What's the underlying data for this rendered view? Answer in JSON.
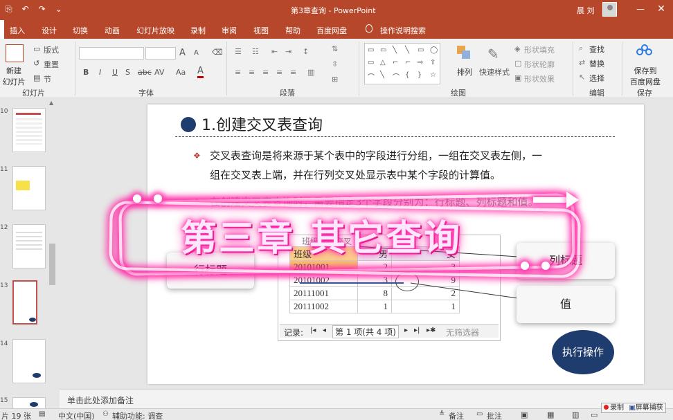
{
  "window": {
    "title": "第3章查询  -  PowerPoint",
    "user": "晨 刘",
    "qat": [
      "⎘",
      "↶",
      "↷",
      "⌄"
    ],
    "minimize": "—",
    "close": "✕"
  },
  "menu": {
    "tabs": [
      "插入",
      "设计",
      "切换",
      "动画",
      "幻灯片放映",
      "录制",
      "审阅",
      "视图",
      "帮助",
      "百度网盘"
    ],
    "tell_me": "操作说明搜索"
  },
  "ribbon": {
    "slides": {
      "new_slide": "新建",
      "new_slide2": "幻灯片",
      "layout": "版式",
      "reset": "重置",
      "section": "节",
      "label": "幻灯片"
    },
    "font": {
      "bold": "B",
      "italic": "I",
      "underline": "U",
      "strike": "S",
      "shadow": "abc",
      "spacing": "AV",
      "case": "Aa",
      "color": "A",
      "grow": "A",
      "shrink": "A",
      "label": "字体"
    },
    "paragraph": {
      "label": "段落"
    },
    "drawing": {
      "arrange": "排列",
      "quick_styles": "快速样式",
      "fill": "形状填充",
      "outline": "形状轮廓",
      "effects": "形状效果",
      "label": "绘图"
    },
    "editing": {
      "find": "查找",
      "replace": "替换",
      "select": "选择",
      "label": "编辑"
    },
    "save": {
      "save_to": "保存到",
      "baidu": "百度网盘",
      "label": "保存"
    }
  },
  "thumbnails": [
    "10",
    "11",
    "12",
    "13",
    "14",
    "15"
  ],
  "slide": {
    "title": "1.创建交叉表查询",
    "bullet1_line1": "交叉表查询是将来源于某个表中的字段进行分组，一组在交叉表左侧，一",
    "bullet1_line2": "组在交叉表上端，并在行列交叉处显示表中某个字段的计算值。",
    "bullet2": "在创建交叉表查询时，需要指定3个字段分别为：行标题、列标题和值。",
    "diamond": "❖",
    "table": {
      "caption": "班级成绩交叉",
      "header": [
        "班级",
        "男",
        "女"
      ],
      "rows": [
        [
          "20101001",
          "2",
          "3"
        ],
        [
          "20101002",
          "3",
          "9"
        ],
        [
          "20111001",
          "8",
          "2"
        ],
        [
          "20111002",
          "1",
          "1"
        ]
      ],
      "nav_record": "记录:",
      "nav_first": "|◂",
      "nav_prev": "◂",
      "nav_pos": "第 1 项(共 4 项)",
      "nav_next": "▸",
      "nav_last": "▸|",
      "nav_new": "▸✱",
      "nav_filter": "无筛选器"
    },
    "row_title": "行标题",
    "col_title": "列标题",
    "value": "值",
    "execute": "执行操作"
  },
  "overlay": {
    "chapter": "第三章  其它查询"
  },
  "notes": {
    "placeholder": "单击此处添加备注"
  },
  "status": {
    "slide_count": "片 19 张",
    "language": "中文(中国)",
    "accessibility": "辅助功能: 调查",
    "notes": "备注",
    "comments": "批注"
  },
  "recorder": {
    "record": "录制",
    "capture": "屏幕捕获"
  },
  "colors": {
    "accent": "#b7472a",
    "title_bullet": "#1f3c6e",
    "neon": "#ff2fa7"
  }
}
